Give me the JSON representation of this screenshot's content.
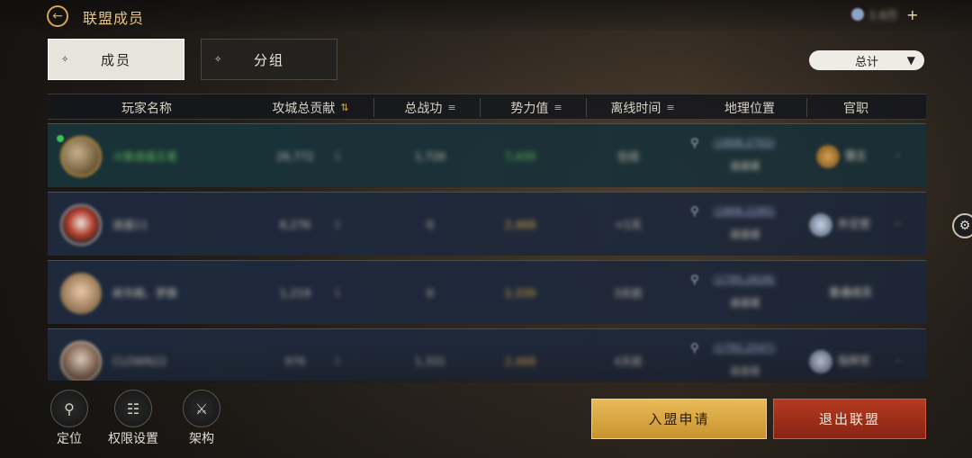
{
  "header": {
    "back_icon": "arrow-left-icon",
    "title": "联盟成员",
    "currency_value": "1.6万",
    "currency_plus": "+"
  },
  "tabs": [
    {
      "label": "成员",
      "active": true
    },
    {
      "label": "分组",
      "active": false
    }
  ],
  "filter": {
    "selected": "总计",
    "caret": "▼"
  },
  "table": {
    "headers": [
      "玩家名称",
      "攻城总贡献",
      "总战功",
      "势力值",
      "离线时间",
      "地理位置",
      "官职"
    ],
    "sort_icon": "sort-icon",
    "rows": [
      {
        "name": "斗鱼逍遥王者",
        "contribution": "26,772",
        "rank_mark": "1",
        "merit": "1,726",
        "power": "7,430",
        "offline": "在线",
        "loc_coord": "(1808,2702)",
        "loc_region": "逍遥城",
        "title": "盟主",
        "online": true
      },
      {
        "name": "逍遥11",
        "contribution": "6,276",
        "rank_mark": "1",
        "merit": "0",
        "power": "2,468",
        "offline": "<1天",
        "loc_coord": "(1806,2285)",
        "loc_region": "逍遥城",
        "title": "外交官",
        "online": false
      },
      {
        "name": "疯华殿、梦霖",
        "contribution": "1,219",
        "rank_mark": "1",
        "merit": "0",
        "power": "2,339",
        "offline": "3天前",
        "loc_coord": "(1795,2628)",
        "loc_region": "逍遥城",
        "title": "普通成员",
        "online": false
      },
      {
        "name": "CLOWN22",
        "contribution": "976",
        "rank_mark": "1",
        "merit": "1,331",
        "power": "2,468",
        "offline": "4天前",
        "loc_coord": "(1792,2547)",
        "loc_region": "逍遥城",
        "title": "指挥官",
        "online": false
      }
    ]
  },
  "sidebar_gear_icon": "gear-icon",
  "toolbar": {
    "items": [
      {
        "label": "定位",
        "icon": "map-pin-icon"
      },
      {
        "label": "权限设置",
        "icon": "permission-icon"
      },
      {
        "label": "架构",
        "icon": "structure-icon"
      }
    ]
  },
  "buttons": {
    "join": "入盟申请",
    "quit": "退出联盟"
  },
  "colors": {
    "accent_gold": "#d7a64a",
    "join_button": "#e0ad48",
    "quit_button": "#a8321c",
    "online_green": "#39c25a"
  }
}
